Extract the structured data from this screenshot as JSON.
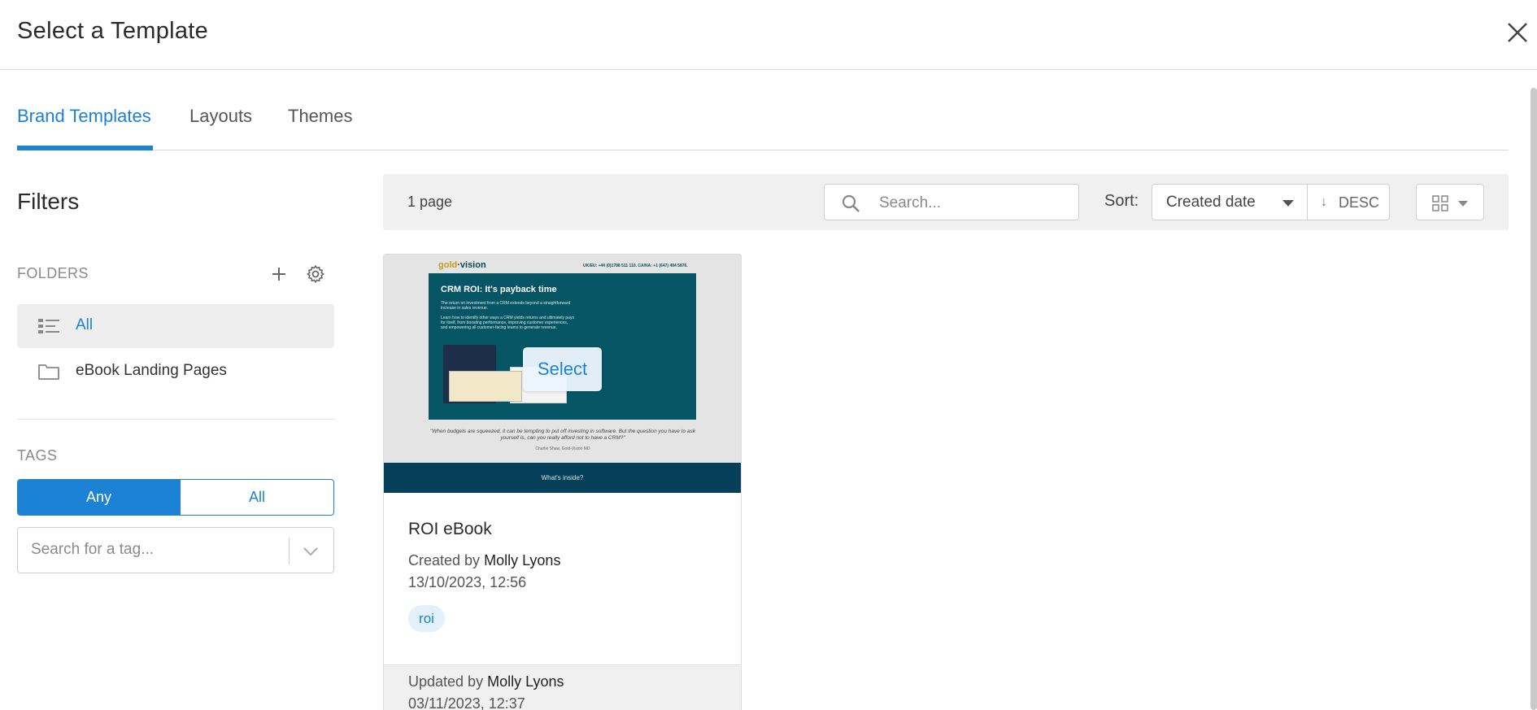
{
  "modal": {
    "title": "Select a Template"
  },
  "tabs": [
    {
      "label": "Brand Templates",
      "active": true
    },
    {
      "label": "Layouts",
      "active": false
    },
    {
      "label": "Themes",
      "active": false
    }
  ],
  "filters": {
    "title": "Filters",
    "folders_label": "FOLDERS",
    "folders": [
      {
        "label": "All",
        "icon": "list-icon",
        "active": true
      },
      {
        "label": "eBook Landing Pages",
        "icon": "folder-icon",
        "active": false
      }
    ],
    "tags_label": "TAGS",
    "tag_match": {
      "any": "Any",
      "all": "All",
      "selected": "Any"
    },
    "tag_search_placeholder": "Search for a tag..."
  },
  "toolbar": {
    "page_count": "1 page",
    "search_placeholder": "Search...",
    "sort_label": "Sort:",
    "sort_value": "Created date",
    "sort_direction": "DESC",
    "view_mode": "grid"
  },
  "templates": [
    {
      "name": "ROI eBook",
      "created_prefix": "Created by",
      "created_by": "Molly Lyons",
      "created_at": "13/10/2023, 12:56",
      "tag": "roi",
      "updated_prefix": "Updated by",
      "updated_by": "Molly Lyons",
      "updated_at": "03/11/2023, 12:37",
      "select_label": "Select",
      "thumbnail": {
        "logo_prefix": "gold",
        "logo_suffix": "vision",
        "contact": "UK/EU: +44 (0)1788 511 110. CA/NA: +1 (647) 494 5876.",
        "headline": "CRM ROI: It's payback time",
        "para1": "The return on investment from a CRM extends beyond a straightforward increase in sales revenue.",
        "para2": "Learn how to identify other ways a CRM yields returns and ultimately pays for itself, from boosting performance, improving customer experiences, and empowering all customer-facing teams to generate revenue.",
        "quote": "\"When budgets are squeezed, it can be tempting to put off investing in software. But the question you have to ask yourself is, can you really afford not to have a CRM?\"",
        "attribution": "Charlie Shaw, Gold-Vision MD",
        "band_text": "What's inside?"
      }
    }
  ],
  "colors": {
    "accent": "#1b82d6",
    "hero_bg": "#065565",
    "band_bg": "#063f5a"
  }
}
